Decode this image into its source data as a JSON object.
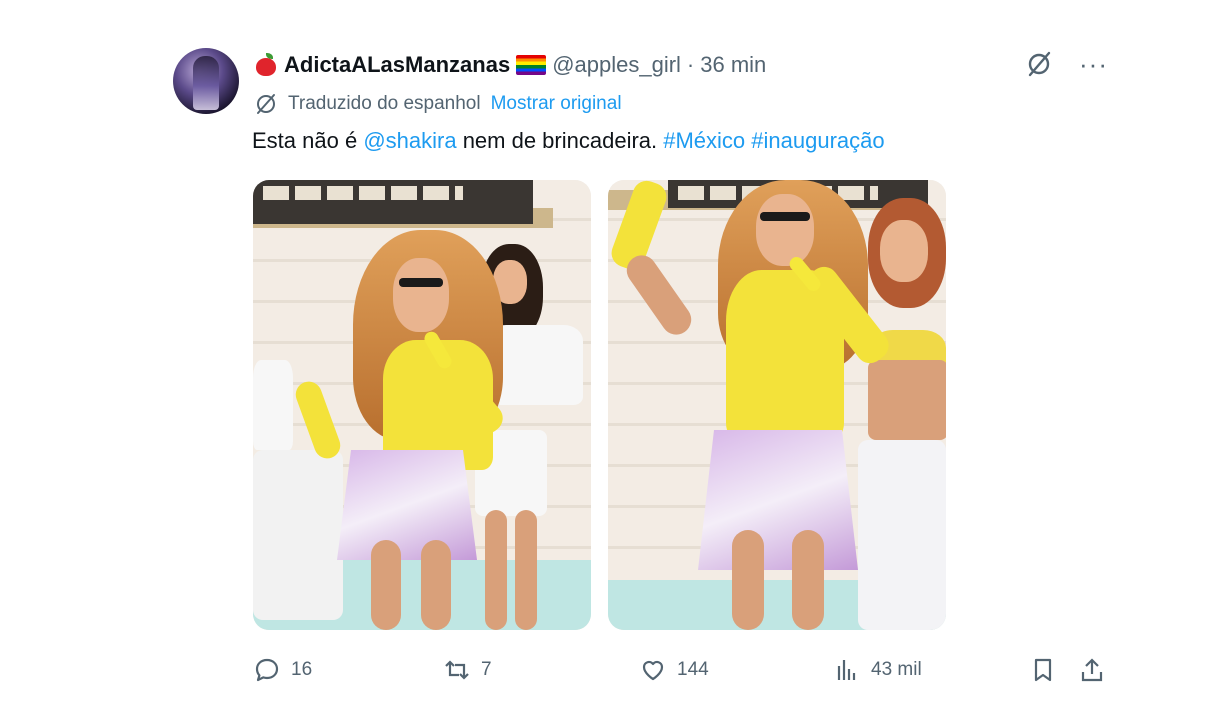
{
  "tweet": {
    "display_name": "AdictaALasManzanas",
    "handle": "@apples_girl",
    "separator": "·",
    "time": "36 min",
    "translated_label": "Traduzido do espanhol",
    "show_original": "Mostrar original",
    "text_before": "Esta não é ",
    "mention": "@shakira",
    "text_middle": " nem de brincadeira. ",
    "hashtag1": "#México",
    "hashtag2": "#inauguração",
    "more_label": "···"
  },
  "actions": {
    "replies": "16",
    "reposts": "7",
    "likes": "144",
    "views": "43 mil"
  },
  "colors": {
    "link": "#1d9bf0",
    "secondary_text": "#536471",
    "primary_text": "#0f1419"
  },
  "icons": [
    "apple-emoji-icon",
    "rainbow-flag-icon",
    "grok-icon",
    "more-icon",
    "translate-icon",
    "reply-icon",
    "repost-icon",
    "like-icon",
    "views-icon",
    "bookmark-icon",
    "share-icon"
  ]
}
